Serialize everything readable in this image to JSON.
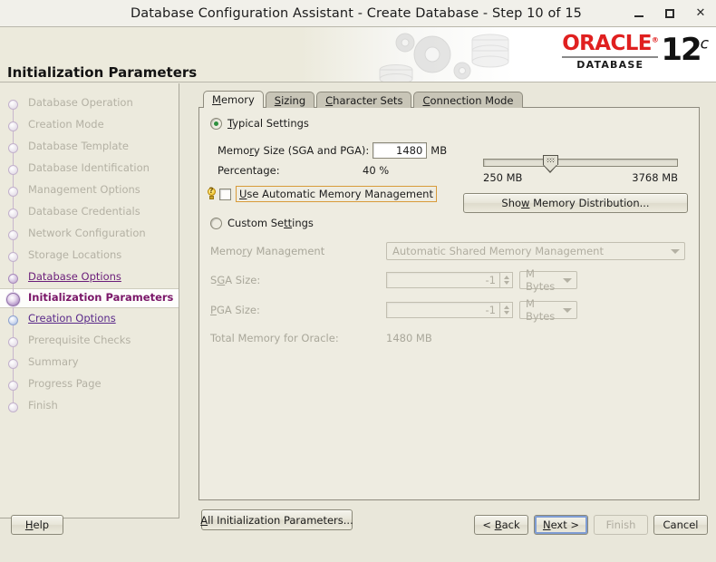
{
  "window": {
    "title": "Database Configuration Assistant - Create Database - Step 10 of 15",
    "minimize_label": "–",
    "maximize_label": "□",
    "close_label": "✕"
  },
  "banner": {
    "page_title": "Initialization Parameters",
    "brand": "ORACLE",
    "brand_reg": "®",
    "brand_sub": "DATABASE",
    "version": "12",
    "version_sup": "c"
  },
  "sidebar": {
    "items": [
      {
        "label": "Database Operation",
        "state": "done"
      },
      {
        "label": "Creation Mode",
        "state": "done"
      },
      {
        "label": "Database Template",
        "state": "done"
      },
      {
        "label": "Database Identification",
        "state": "done"
      },
      {
        "label": "Management Options",
        "state": "done"
      },
      {
        "label": "Database Credentials",
        "state": "done"
      },
      {
        "label": "Network Configuration",
        "state": "done"
      },
      {
        "label": "Storage Locations",
        "state": "done"
      },
      {
        "label": "Database Options",
        "state": "link"
      },
      {
        "label": "Initialization Parameters",
        "state": "current"
      },
      {
        "label": "Creation Options",
        "state": "link-blue"
      },
      {
        "label": "Prerequisite Checks",
        "state": "done"
      },
      {
        "label": "Summary",
        "state": "done"
      },
      {
        "label": "Progress Page",
        "state": "done"
      },
      {
        "label": "Finish",
        "state": "done"
      }
    ]
  },
  "tabs": [
    {
      "label": "Memory",
      "mnemonic": "M",
      "active": true
    },
    {
      "label": "Sizing",
      "mnemonic": "S",
      "active": false
    },
    {
      "label": "Character Sets",
      "mnemonic": "C",
      "active": false
    },
    {
      "label": "Connection Mode",
      "mnemonic": "C",
      "active": false
    }
  ],
  "memory_tab": {
    "typical_radio_label": "Typical Settings",
    "typical_selected": true,
    "memory_size_label": "Memory Size (SGA and PGA):",
    "memory_size_value": "1480",
    "memory_size_unit": "MB",
    "percentage_label": "Percentage:",
    "percentage_value": "40 %",
    "amm_checkbox_label": "Use Automatic Memory Management",
    "amm_checked": false,
    "slider_min_label": "250 MB",
    "slider_max_label": "3768 MB",
    "show_memory_distribution_label": "Show Memory Distribution...",
    "custom_radio_label": "Custom Settings",
    "custom_selected": false,
    "memory_management_label": "Memory Management",
    "memory_management_value": "Automatic Shared Memory Management",
    "sga_size_label": "SGA Size:",
    "sga_size_value": "-1",
    "sga_size_unit": "M Bytes",
    "pga_size_label": "PGA Size:",
    "pga_size_value": "-1",
    "pga_size_unit": "M Bytes",
    "total_memory_label": "Total Memory for Oracle:",
    "total_memory_value": "1480 MB"
  },
  "actions": {
    "all_init_params_label": "All Initialization Parameters...",
    "help_label": "Help",
    "back_label": "< Back",
    "next_label": "Next >",
    "finish_label": "Finish",
    "cancel_label": "Cancel"
  },
  "colors": {
    "panel_bg": "#eeece1",
    "window_bg": "#e9e7da",
    "accent_purple": "#7a1668",
    "brand_red": "#e02020",
    "focus_orange": "#d89b3a",
    "focus_blue": "#7f9dd4"
  }
}
